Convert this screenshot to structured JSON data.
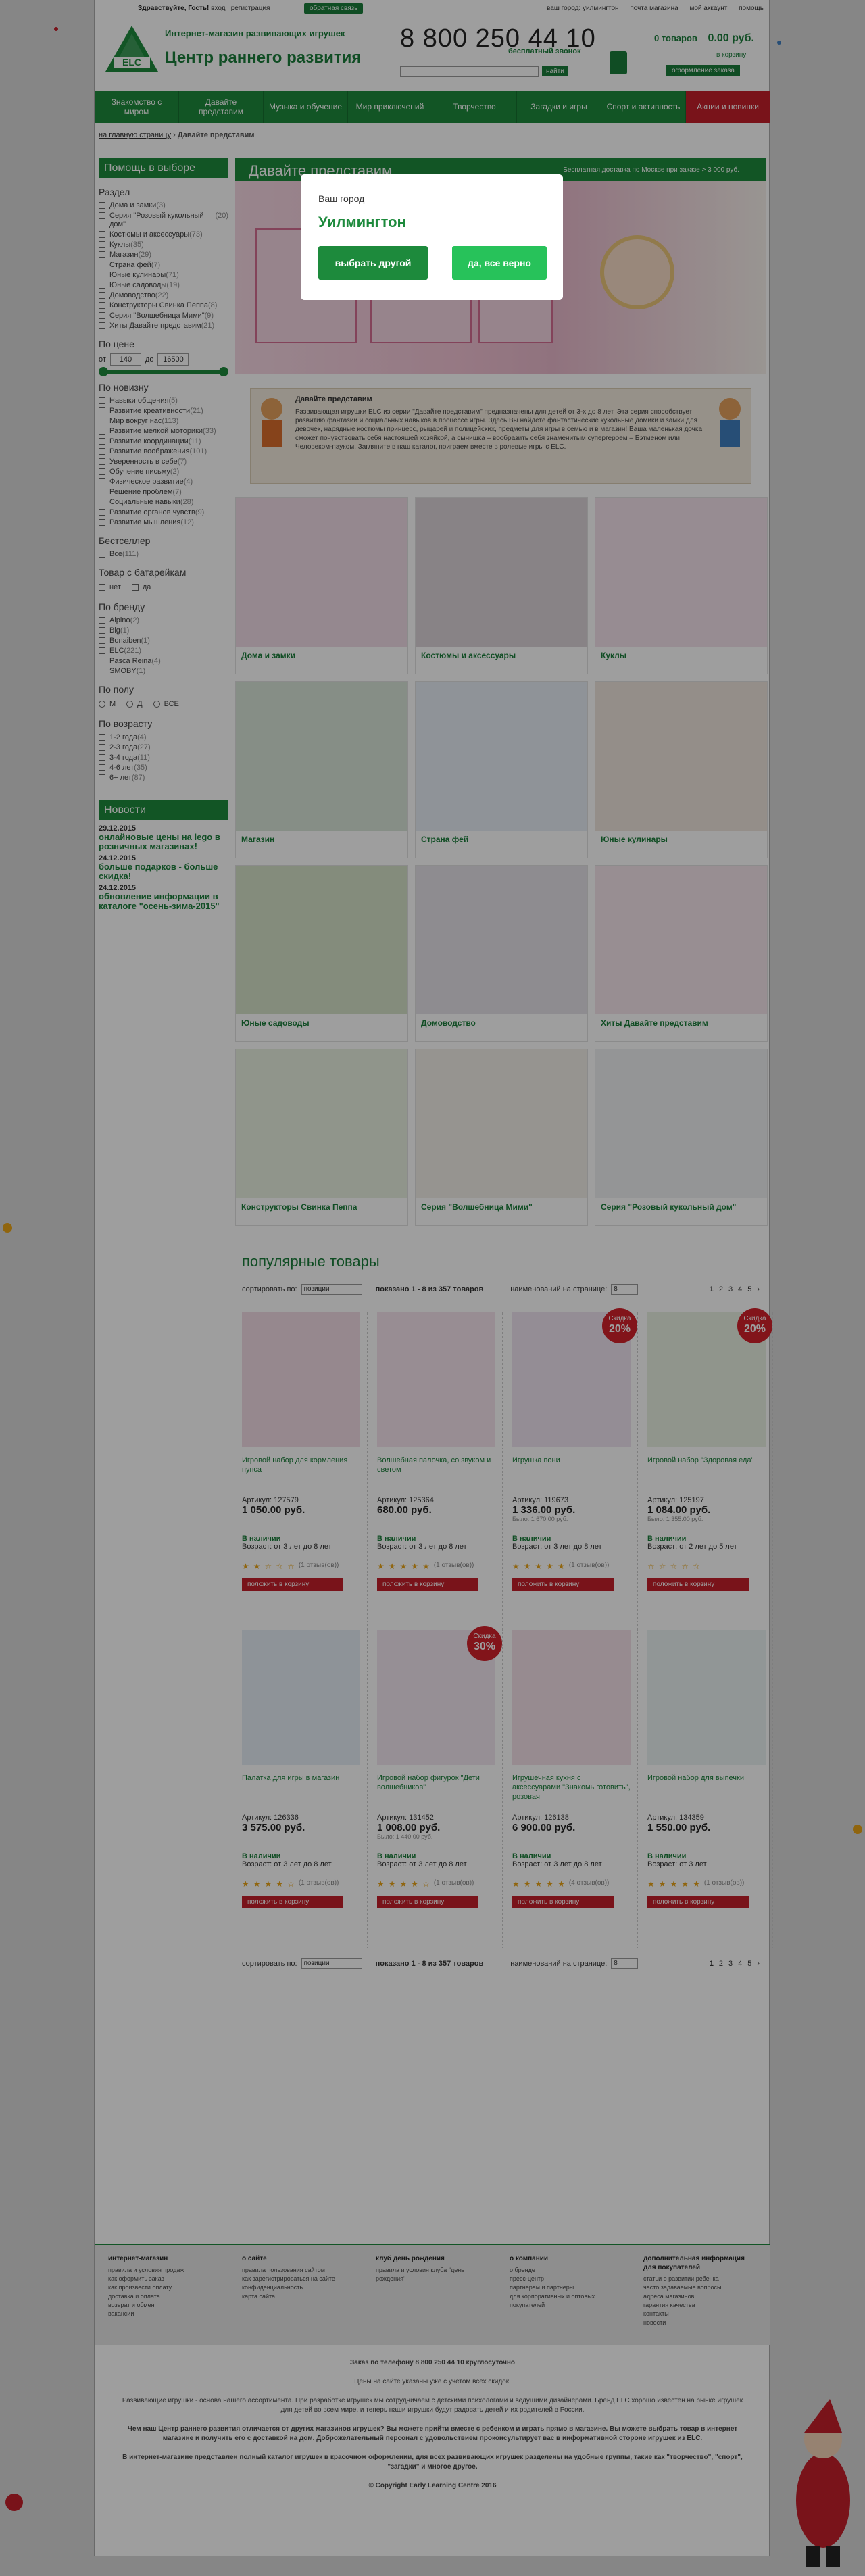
{
  "topbar": {
    "greeting_prefix": "Здравствуйте, Гость!",
    "login": "вход",
    "register": "регистрация",
    "feedback_button": "обратная связь",
    "links": [
      "ваш город: уилмингтон",
      "почта магазина",
      "мой аккаунт",
      "помощь"
    ]
  },
  "header": {
    "slogan": "Интернет-магазин развивающих игрушек",
    "store_name": "Центр раннего развития",
    "logo_text": "ELC",
    "phone": "8 800 250 44 10",
    "phone_note": "бесплатный звонок",
    "search_placeholder": "",
    "search_button": "найти",
    "cart_count": "0 товаров",
    "cart_total": "0.00 руб.",
    "cart_link": "в корзину",
    "checkout_button": "оформление заказа"
  },
  "nav": [
    "Знакомство с миром",
    "Давайте представим",
    "Музыка и обучение",
    "Мир приключений",
    "Творчество",
    "Загадки и игры",
    "Спорт и активность",
    "Акции и новинки"
  ],
  "breadcrumb": {
    "home": "на главную страницу",
    "separator": "›",
    "current": "Давайте представим"
  },
  "sidebar": {
    "header": "Помощь в выборе",
    "section_razdel": "Раздел",
    "razdel_items": [
      {
        "label": "Дома и замки",
        "count": "(3)"
      },
      {
        "label": "Серия \"Розовый кукольный дом\"",
        "count": "(20)"
      },
      {
        "label": "Костюмы и аксессуары",
        "count": "(73)"
      },
      {
        "label": "Куклы",
        "count": "(35)"
      },
      {
        "label": "Магазин",
        "count": "(29)"
      },
      {
        "label": "Страна фей",
        "count": "(7)"
      },
      {
        "label": "Юные кулинары",
        "count": "(71)"
      },
      {
        "label": "Юные садоводы",
        "count": "(19)"
      },
      {
        "label": "Домоводство",
        "count": "(22)"
      },
      {
        "label": "Конструкторы Свинка Пеппа",
        "count": "(8)"
      },
      {
        "label": "Серия \"Волшебница Мими\"",
        "count": "(9)"
      },
      {
        "label": "Хиты Давайте представим",
        "count": "(21)"
      }
    ],
    "section_price": "По цене",
    "price_from_label": "от",
    "price_from": "140",
    "price_to_label": "до",
    "price_to": "16500",
    "section_new": "По новизну",
    "new_items": [
      {
        "label": "Навыки общения",
        "count": "(5)"
      },
      {
        "label": "Развитие креативности",
        "count": "(21)"
      },
      {
        "label": "Мир вокруг нас",
        "count": "(113)"
      },
      {
        "label": "Развитие мелкой моторики",
        "count": "(33)"
      },
      {
        "label": "Развитие координации",
        "count": "(11)"
      },
      {
        "label": "Развитие воображения",
        "count": "(101)"
      },
      {
        "label": "Уверенность в себе",
        "count": "(7)"
      },
      {
        "label": "Обучение письму",
        "count": "(2)"
      },
      {
        "label": "Физическое развитие",
        "count": "(4)"
      },
      {
        "label": "Решение проблем",
        "count": "(7)"
      },
      {
        "label": "Социальные навыки",
        "count": "(28)"
      },
      {
        "label": "Развитие органов чувств",
        "count": "(9)"
      },
      {
        "label": "Развитие мышления",
        "count": "(12)"
      }
    ],
    "section_bestseller": "Бестселлер",
    "bestseller_items": [
      {
        "label": "Все",
        "count": "(111)"
      }
    ],
    "section_batteries": "Товар с батарейкам",
    "battery_no": "нет",
    "battery_yes": "да",
    "section_brand": "По бренду",
    "brand_items": [
      {
        "label": "Alpino",
        "count": "(2)"
      },
      {
        "label": "Big",
        "count": "(1)"
      },
      {
        "label": "Bonaiben",
        "count": "(1)"
      },
      {
        "label": "ELC",
        "count": "(221)"
      },
      {
        "label": "Pasca Reina",
        "count": "(4)"
      },
      {
        "label": "SMOBY",
        "count": "(1)"
      }
    ],
    "section_gender": "По полу",
    "gender_m": "М",
    "gender_f": "Д",
    "gender_all": "ВСЕ",
    "section_age": "По возрасту",
    "age_items": [
      {
        "label": "1-2 года",
        "count": "(4)"
      },
      {
        "label": "2-3 года",
        "count": "(27)"
      },
      {
        "label": "3-4 года",
        "count": "(11)"
      },
      {
        "label": "4-6 лет",
        "count": "(35)"
      },
      {
        "label": "6+ лет",
        "count": "(87)"
      }
    ],
    "news_header": "Новости",
    "news": [
      {
        "date": "29.12.2015",
        "text": "онлайновые цены на lego в розничных магазинах!"
      },
      {
        "date": "24.12.2015",
        "text": "больше подарков - больше скидка!"
      },
      {
        "date": "24.12.2015",
        "text": "обновление информации в каталоге \"осень-зима-2015\""
      }
    ]
  },
  "banner": {
    "title": "Давайте представим",
    "delivery": "Бесплатная доставка по Москве при заказе > 3 000 руб."
  },
  "description": {
    "title": "Давайте представим",
    "text": "Развивающая игрушки ELC из серии \"Давайте представим\" предназначены для детей от 3-х до 8 лет. Эта серия способствует развитию фантазии и социальных навыков в процессе игры. Здесь Вы найдете фантастические кукольные домики и замки для девочек, нарядные костюмы принцесс, рыцарей и полицейских, предметы для игры в семью и в магазин! Ваша маленькая дочка сможет почувствовать себя настоящей хозяйкой, а сынишка – вообразить себя знаменитым супергероем – Бэтменом или Человеком-пауком. Загляните в наш каталог, поиграем вместе в ролевые игры с ELC."
  },
  "categories": [
    "Дома и замки",
    "Костюмы и аксессуары",
    "Куклы",
    "Магазин",
    "Страна фей",
    "Юные кулинары",
    "Юные садоводы",
    "Домоводство",
    "Хиты Давайте представим",
    "Конструкторы Свинка Пеппа",
    "Серия \"Волшебница Мими\"",
    "Серия \"Розовый кукольный дом\""
  ],
  "popular": {
    "title": "популярные товары",
    "sort_label": "сортировать по:",
    "sort_value": "позиции",
    "shown": "показано 1 - 8 из 357 товаров",
    "per_page_label": "наименований на странице:",
    "per_page_value": "8",
    "pages": [
      "1",
      "2",
      "3",
      "4",
      "5",
      "›"
    ]
  },
  "products": [
    {
      "name": "Игровой набор для кормления пупса",
      "article": "Артикул: 127579",
      "price": "1 050.00 руб.",
      "old": "",
      "stock": "В наличии",
      "age": "Возраст:  от 3 лет до 8 лет",
      "reviews": "(1 отзыв(ов))",
      "badge": "",
      "cart": "положить в корзину"
    },
    {
      "name": "Волшебная палочка, со звуком и светом",
      "article": "Артикул: 125364",
      "price": "680.00 руб.",
      "old": "",
      "stock": "В наличии",
      "age": "Возраст:  от 3 лет до 8 лет",
      "reviews": "(1 отзыв(ов))",
      "badge": "",
      "cart": "положить в корзину"
    },
    {
      "name": "Игрушка пони",
      "article": "Артикул: 119673",
      "price": "1 336.00 руб.",
      "old": "Было: 1 670.00 руб.",
      "stock": "В наличии",
      "age": "Возраст:  от 3 лет до 8 лет",
      "reviews": "(1 отзыв(ов))",
      "badge": "20%",
      "cart": "положить в корзину"
    },
    {
      "name": "Игровой набор \"Здоровая еда\"",
      "article": "Артикул: 125197",
      "price": "1 084.00 руб.",
      "old": "Было: 1 355.00 руб.",
      "stock": "В наличии",
      "age": "Возраст:  от 2 лет до 5 лет",
      "reviews": "",
      "badge": "20%",
      "cart": "положить в корзину"
    },
    {
      "name": "Палатка для игры в магазин",
      "article": "Артикул: 126336",
      "price": "3 575.00 руб.",
      "old": "",
      "stock": "В наличии",
      "age": "Возраст:  от 3 лет до 8 лет",
      "reviews": "(1 отзыв(ов))",
      "badge": "",
      "cart": "положить в корзину"
    },
    {
      "name": "Игровой набор фигурок \"Дети волшебников\"",
      "article": "Артикул: 131452",
      "price": "1 008.00 руб.",
      "old": "Было: 1 440.00 руб.",
      "stock": "В наличии",
      "age": "Возраст:  от 3 лет до 8 лет",
      "reviews": "(1 отзыв(ов))",
      "badge": "30%",
      "cart": "положить в корзину"
    },
    {
      "name": "Игрушечная кухня с аксессуарами \"Знакомь готовить\", розовая",
      "article": "Артикул: 126138",
      "price": "6 900.00 руб.",
      "old": "",
      "stock": "В наличии",
      "age": "Возраст:  от 3 лет до 8 лет",
      "reviews": "(4 отзыв(ов))",
      "badge": "",
      "cart": "положить в корзину"
    },
    {
      "name": "Игровой набор для выпечки",
      "article": "Артикул: 134359",
      "price": "1 550.00 руб.",
      "old": "",
      "stock": "В наличии",
      "age": "Возраст:  от 3 лет",
      "reviews": "(1 отзыв(ов))",
      "badge": "",
      "cart": "положить в корзину"
    }
  ],
  "product_ratings": [
    2,
    5,
    5,
    0,
    4,
    4,
    5,
    5
  ],
  "badge_label": "Скидка",
  "footer": {
    "cols": [
      {
        "title": "интернет-магазин",
        "items": [
          "правила и условия продаж",
          "как оформить заказ",
          "как произвести оплату",
          "доставка и оплата",
          "возврат и обмен",
          "вакансии"
        ]
      },
      {
        "title": "о сайте",
        "items": [
          "правила пользования сайтом",
          "как зарегистрироваться на сайте",
          "конфиденциальность",
          "карта сайта"
        ]
      },
      {
        "title": "клуб день рождения",
        "items": [
          "правила и условия клуба \"день рождения\""
        ]
      },
      {
        "title": "о компании",
        "items": [
          "о бренде",
          "пресс-центр",
          "партнерам и партнеры",
          "для корпоративных и оптовых покупателей"
        ]
      },
      {
        "title": "дополнительная информация для покупателей",
        "items": [
          "статьи о развитии ребенка",
          "часто задаваемые вопросы",
          "адреса магазинов",
          "гарантия качества",
          "контакты",
          "новости"
        ]
      }
    ],
    "order_phone": "Заказ по телефону 8 800 250 44 10 круглосуточно",
    "prices_note": "Цены на сайте указаны уже с учетом всех скидок.",
    "about1": "Развивающие игрушки - основа нашего ассортимента. При разработке игрушек мы сотрудничаем с детскими психологами и ведущими дизайнерами. Бренд ELC хорошо известен на рынке игрушек для детей во всем мире, и теперь наши игрушки будут радовать детей и их родителей в России.",
    "about2": "Чем наш Центр раннего развития отличается от других магазинов игрушек? Вы можете прийти вместе с ребенком и играть прямо в магазине. Вы можете выбрать товар в интернет магазине и получить его с доставкой на дом. Доброжелательный персонал с удовольствием проконсультирует вас в информативной стороне игрушек из ELC.",
    "about3": "В интернет-магазине представлен полный каталог игрушек в красочном оформлении, для всех развивающих игрушек разделены на удобные группы, такие как \"творчество\", \"спорт\", \"загадки\" и многое другое.",
    "copyright": "© Copyright Early Learning Centre 2016"
  },
  "modal": {
    "question": "Ваш город",
    "city": "Уилмингтон",
    "other_button": "выбрать другой",
    "confirm_button": "да, все верно"
  },
  "colors": {
    "brand_green": "#1d8a3c",
    "accent_red": "#c4202b",
    "confirm_green": "#27c25a"
  }
}
